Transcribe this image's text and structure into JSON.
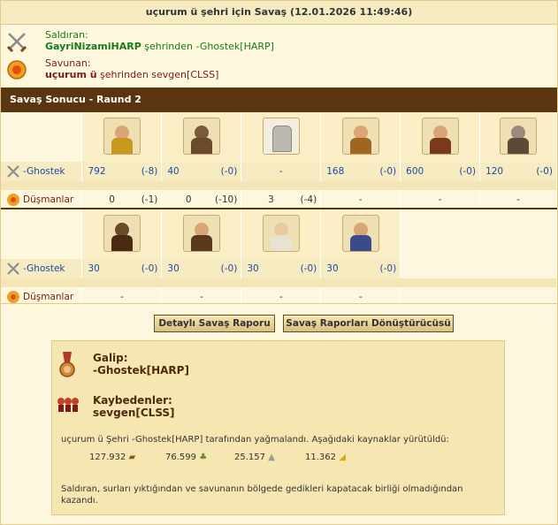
{
  "title": "uçurum ü şehri için Savaş (12.01.2026 11:49:46)",
  "attacker": {
    "label": "Saldıran:",
    "name": "GayriNizamiHARP",
    "suffix": " şehrinden -Ghostek[HARP]",
    "icon": "crossed-swords-icon"
  },
  "defender": {
    "label": "Savunan:",
    "name": "uçurum ü",
    "suffix": " şehrinden sevgen[CLSS]",
    "icon": "shield-icon"
  },
  "result_header": "Savaş Sonucu - Raund 2",
  "round1": {
    "units": [
      "hoplite-icon",
      "catapult-icon",
      "wall-icon",
      "sulfur-carrier-icon",
      "gunner-icon",
      "ballista-icon"
    ],
    "attacker_row": {
      "name": "-Ghostek",
      "cells": [
        {
          "n": "792",
          "d": "(-8)"
        },
        {
          "n": "40",
          "d": "(-0)"
        },
        {
          "n": "-",
          "d": ""
        },
        {
          "n": "168",
          "d": "(-0)"
        },
        {
          "n": "600",
          "d": "(-0)"
        },
        {
          "n": "120",
          "d": "(-0)"
        }
      ]
    },
    "defender_row": {
      "name": "Düşmanlar",
      "cells": [
        {
          "n": "0",
          "d": "(-1)"
        },
        {
          "n": "0",
          "d": "(-10)"
        },
        {
          "n": "3",
          "d": "(-4)"
        },
        {
          "n": "-",
          "d": ""
        },
        {
          "n": "-",
          "d": ""
        },
        {
          "n": "-",
          "d": ""
        }
      ]
    }
  },
  "round2": {
    "units": [
      "battering-ram-icon",
      "mortar-icon",
      "doctor-icon",
      "cook-icon"
    ],
    "attacker_row": {
      "name": "-Ghostek",
      "cells": [
        {
          "n": "30",
          "d": "(-0)"
        },
        {
          "n": "30",
          "d": "(-0)"
        },
        {
          "n": "30",
          "d": "(-0)"
        },
        {
          "n": "30",
          "d": "(-0)"
        }
      ]
    },
    "defender_row": {
      "name": "Düşmanlar",
      "cells": [
        {
          "n": "-",
          "d": ""
        },
        {
          "n": "-",
          "d": ""
        },
        {
          "n": "-",
          "d": ""
        },
        {
          "n": "-",
          "d": ""
        }
      ]
    }
  },
  "buttons": {
    "detailed": "Detaylı Savaş Raporu",
    "converter": "Savaş Raporları Dönüştürücüsü"
  },
  "summary": {
    "winner_label": "Galip:",
    "winner": "-Ghostek[HARP]",
    "losers_label": "Kaybedenler:",
    "loser": "sevgen[CLSS]",
    "plunder_text": "uçurum ü Şehri -Ghostek[HARP] tarafından yağmalandı. Aşağıdaki kaynaklar yürütüldü:",
    "resources": [
      {
        "amount": "127.932",
        "icon": "wood-icon"
      },
      {
        "amount": "76.599",
        "icon": "wine-icon"
      },
      {
        "amount": "25.157",
        "icon": "marble-icon"
      },
      {
        "amount": "11.362",
        "icon": "sulfur-icon"
      }
    ],
    "footer_line1": "Saldıran, surları yıktığından ve savunanın bölgede gedikleri kapatacak birliği olmadığından",
    "footer_line2": "kazandı."
  },
  "colors": {
    "header_brown": "#5a3510",
    "attacker_green": "#1a7a1a",
    "defender_red": "#7a1a1a",
    "value_blue": "#1a4aa8"
  }
}
